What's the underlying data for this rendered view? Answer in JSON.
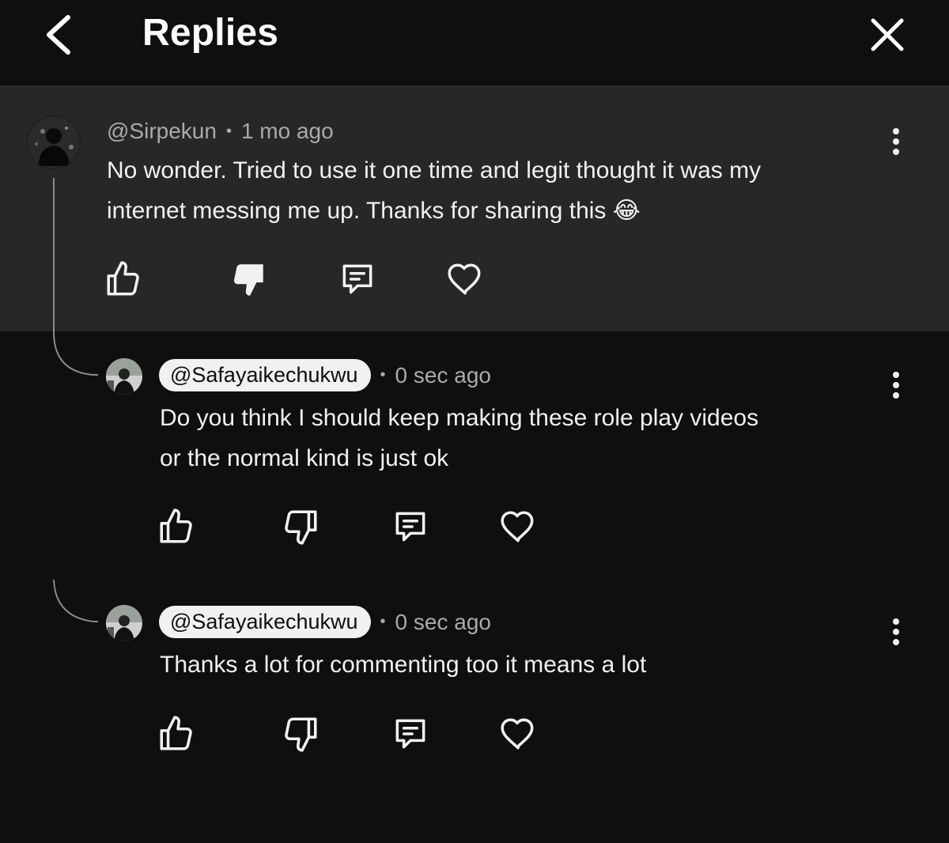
{
  "header": {
    "title": "Replies",
    "back_icon": "chevron-left-icon",
    "close_icon": "close-icon"
  },
  "colors": {
    "background": "#0f0f0f",
    "parent_background": "#272727",
    "text": "#f1f1f1",
    "meta_text": "#aaaaaa",
    "pill_background": "#f1f1f1"
  },
  "parent_comment": {
    "handle": "@Sirpekun",
    "separator": "•",
    "time": "1 mo ago",
    "text_line1": "No wonder. Tried to use it one time and legit thought it was my",
    "text_line2": "internet messing me up. Thanks for sharing this 😂",
    "dislike_active": true
  },
  "replies": [
    {
      "handle": "@Safayaikechukwu",
      "separator": "•",
      "time": "0 sec ago",
      "text_line1": "Do you think I should keep making these role play videos",
      "text_line2": "or the normal kind  is just ok"
    },
    {
      "handle": "@Safayaikechukwu",
      "separator": "•",
      "time": "0 sec ago",
      "text_line1": "Thanks a lot for commenting too it means a lot"
    }
  ],
  "action_icons": [
    "thumbs-up-icon",
    "thumbs-down-icon",
    "reply-comment-icon",
    "heart-icon"
  ],
  "menu_icon": "more-vertical-icon"
}
